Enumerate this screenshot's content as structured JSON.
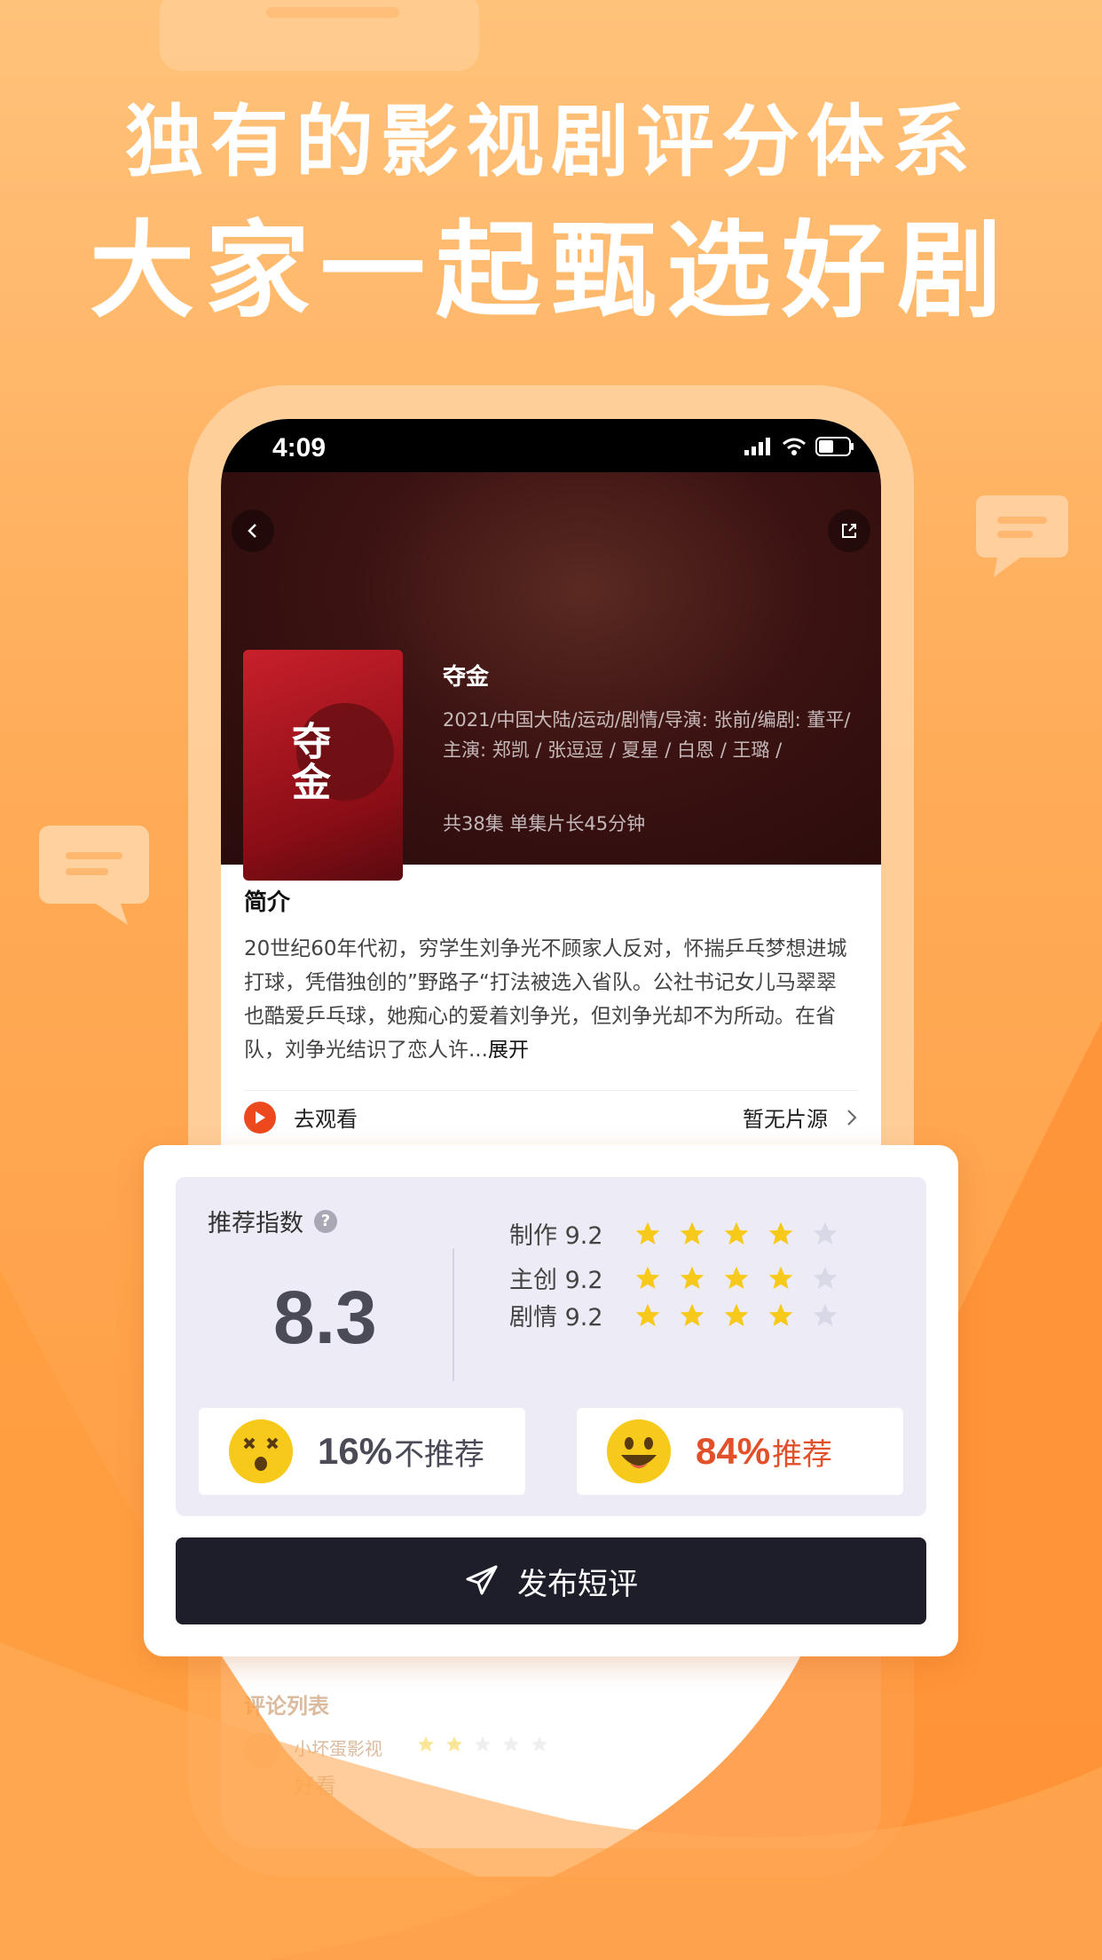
{
  "hero": {
    "line1": "独有的影视剧评分体系",
    "line2": "大家一起甄选好剧"
  },
  "status_bar": {
    "time": "4:09"
  },
  "movie": {
    "title": "夺金",
    "poster_title": "夺金",
    "meta": "2021/中国大陆/运动/剧情/导演: 张前/编剧: 董平/主演: 郑凯 / 张逗逗 / 夏星 / 白恩 / 王璐 /",
    "episodes": "共38集 单集片长45分钟"
  },
  "intro": {
    "title": "简介",
    "text": "20世纪60年代初，穷学生刘争光不顾家人反对，怀揣乒乓梦想进城打球，凭借独创的”野路子“打法被选入省队。公社书记女儿马翠翠也酷爱乒乓球，她痴心的爱着刘争光，但刘争光却不为所动。在省队，刘争光结识了恋人许...",
    "more": "展开"
  },
  "watch": {
    "label": "去观看",
    "status": "暂无片源"
  },
  "rating": {
    "label": "推荐指数",
    "score": "8.3",
    "rows": [
      {
        "label": "制作 9.2",
        "stars": 4
      },
      {
        "label": "主创 9.2",
        "stars": 4
      },
      {
        "label": "剧情 9.2",
        "stars": 4
      }
    ],
    "not_recommend": {
      "pct": "16%",
      "text": "不推荐"
    },
    "recommend": {
      "pct": "84%",
      "text": "推荐"
    }
  },
  "publish_label": "发布短评",
  "comments": {
    "title": "评论列表",
    "first": {
      "user": "小坏蛋影视",
      "text": "好看",
      "stars": 2
    }
  },
  "colors": {
    "accent_orange": "#ec4a1e",
    "star_yellow": "#f7c91b",
    "star_empty": "#d9d8e6",
    "button_dark": "#1e1e2a"
  }
}
